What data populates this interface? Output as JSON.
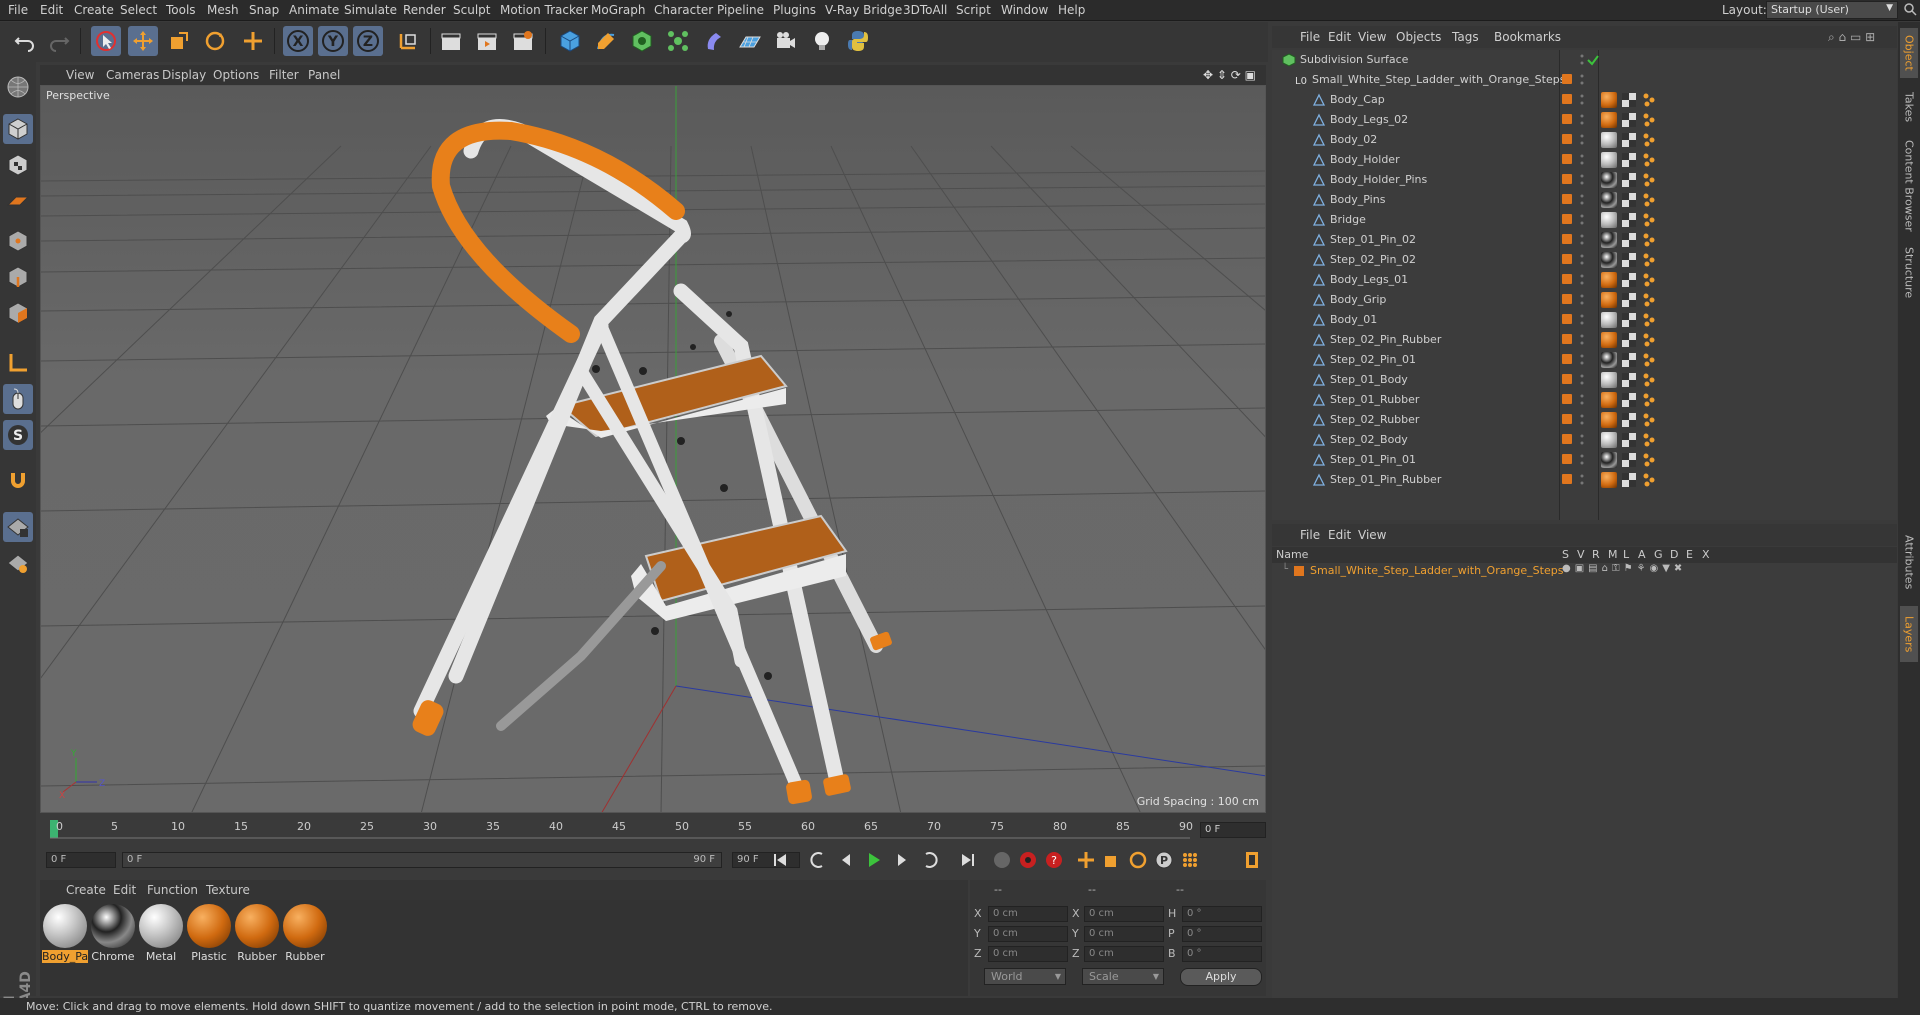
{
  "menubar": {
    "items": [
      "File",
      "Edit",
      "Create",
      "Select",
      "Tools",
      "Mesh",
      "Snap",
      "Animate",
      "Simulate",
      "Render",
      "Sculpt",
      "Motion Tracker",
      "MoGraph",
      "Character",
      "Pipeline",
      "Plugins",
      "V-Ray Bridge",
      "3DToAll",
      "Script",
      "Window",
      "Help"
    ],
    "layout_label": "Layout:",
    "layout_value": "Startup (User)"
  },
  "viewport": {
    "menu": [
      "View",
      "Cameras",
      "Display",
      "Options",
      "Filter",
      "Panel"
    ],
    "camera_label": "Perspective",
    "grid_spacing": "Grid Spacing : 100 cm"
  },
  "timeline": {
    "ticks": [
      "0",
      "5",
      "10",
      "15",
      "20",
      "25",
      "30",
      "35",
      "40",
      "45",
      "50",
      "55",
      "60",
      "65",
      "70",
      "75",
      "80",
      "85",
      "90"
    ],
    "end_frame_right": "0 F",
    "current_frame": "0 F",
    "range_start": "0 F",
    "range_end": "90 F",
    "max_frame": "90 F"
  },
  "materials": {
    "menu": [
      "Create",
      "Edit",
      "Function",
      "Texture"
    ],
    "items": [
      {
        "label": "Body_Pa",
        "type": "white",
        "selected": true
      },
      {
        "label": "Chrome",
        "type": "chrome",
        "selected": false
      },
      {
        "label": "Metal",
        "type": "white",
        "selected": false
      },
      {
        "label": "Plastic",
        "type": "orange",
        "selected": false
      },
      {
        "label": "Rubber",
        "type": "orange",
        "selected": false
      },
      {
        "label": "Rubber",
        "type": "orange",
        "selected": false
      }
    ]
  },
  "coordinates": {
    "header": [
      "--",
      "--",
      "--"
    ],
    "rows": [
      {
        "a": "X",
        "av": "0 cm",
        "b": "X",
        "bv": "0 cm",
        "c": "H",
        "cv": "0 °"
      },
      {
        "a": "Y",
        "av": "0 cm",
        "b": "Y",
        "bv": "0 cm",
        "c": "P",
        "cv": "0 °"
      },
      {
        "a": "Z",
        "av": "0 cm",
        "b": "Z",
        "bv": "0 cm",
        "c": "B",
        "cv": "0 °"
      }
    ],
    "world": "World",
    "scale": "Scale",
    "apply": "Apply"
  },
  "status": "Move: Click and drag to move elements. Hold down SHIFT to quantize movement / add to the selection in point mode, CTRL to remove.",
  "object_manager": {
    "menu": [
      "File",
      "Edit",
      "View",
      "Objects",
      "Tags",
      "Bookmarks"
    ],
    "root": "Subdivision Surface",
    "group": "Small_White_Step_Ladder_with_Orange_Steps",
    "children": [
      {
        "name": "Body_Cap",
        "mat": "orange"
      },
      {
        "name": "Body_Legs_02",
        "mat": "orange"
      },
      {
        "name": "Body_02",
        "mat": "white"
      },
      {
        "name": "Body_Holder",
        "mat": "white"
      },
      {
        "name": "Body_Holder_Pins",
        "mat": "chrome"
      },
      {
        "name": "Body_Pins",
        "mat": "chrome"
      },
      {
        "name": "Bridge",
        "mat": "white"
      },
      {
        "name": "Step_01_Pin_02",
        "mat": "chrome"
      },
      {
        "name": "Step_02_Pin_02",
        "mat": "chrome"
      },
      {
        "name": "Body_Legs_01",
        "mat": "orange"
      },
      {
        "name": "Body_Grip",
        "mat": "orange"
      },
      {
        "name": "Body_01",
        "mat": "white"
      },
      {
        "name": "Step_02_Pin_Rubber",
        "mat": "orange"
      },
      {
        "name": "Step_02_Pin_01",
        "mat": "chrome"
      },
      {
        "name": "Step_01_Body",
        "mat": "white"
      },
      {
        "name": "Step_01_Rubber",
        "mat": "orange"
      },
      {
        "name": "Step_02_Rubber",
        "mat": "orange"
      },
      {
        "name": "Step_02_Body",
        "mat": "white"
      },
      {
        "name": "Step_01_Pin_01",
        "mat": "chrome"
      },
      {
        "name": "Step_01_Pin_Rubber",
        "mat": "orange"
      }
    ]
  },
  "layer_manager": {
    "menu": [
      "File",
      "Edit",
      "View"
    ],
    "columns": [
      "Name",
      "S",
      "V",
      "R",
      "M",
      "L",
      "A",
      "G",
      "D",
      "E",
      "X"
    ],
    "layer_name": "Small_White_Step_Ladder_with_Orange_Steps"
  },
  "right_tabs": [
    "Object",
    "Takes",
    "Content Browser",
    "Structure",
    "Attributes",
    "Layers"
  ],
  "colors": {
    "accent_orange": "#e0761e",
    "selection_blue": "#5a6f8f",
    "ladder_white": "#e8e8e8",
    "ladder_orange": "#e8801a"
  }
}
